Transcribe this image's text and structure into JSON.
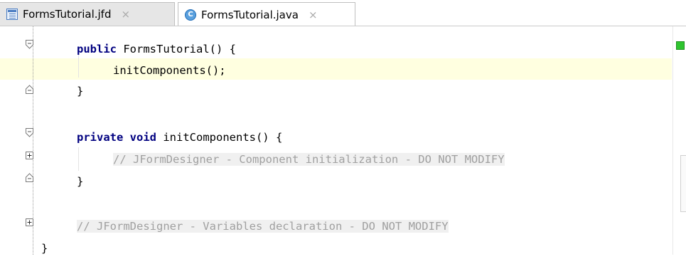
{
  "tabs": [
    {
      "label": "FormsTutorial.jfd",
      "icon": "form-file-icon",
      "close": "×",
      "active": false
    },
    {
      "label": "FormsTutorial.java",
      "icon": "java-class-icon",
      "class_letter": "C",
      "close": "×",
      "active": true
    }
  ],
  "editor": {
    "lines": [
      {
        "kw": "public",
        "text": " FormsTutorial() {"
      },
      {
        "text": "initComponents();"
      },
      {
        "text": "}"
      },
      {
        "kw": "private",
        "kw2": "void",
        "text": " initComponents() {"
      },
      {
        "comment": "// JFormDesigner - Component initialization - DO NOT MODIFY"
      },
      {
        "text": "}"
      },
      {
        "comment": "// JFormDesigner - Variables declaration - DO NOT MODIFY"
      },
      {
        "text": "}"
      }
    ]
  },
  "colors": {
    "keyword": "#000080",
    "comment": "#a0a0a0",
    "current_line": "#ffffe0",
    "status_ok": "#2ec42e"
  }
}
